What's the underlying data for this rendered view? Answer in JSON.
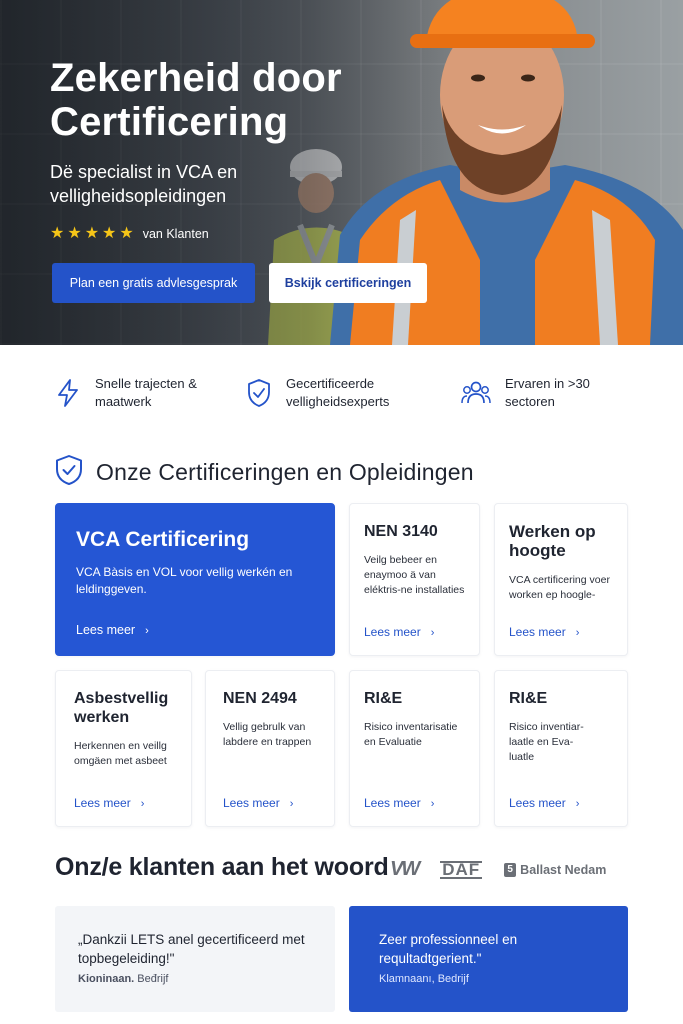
{
  "hero": {
    "title": "Zekerheid door Certificering",
    "subtitle": "Dë specialist in VCA en velligheidsopleidingen",
    "rating": {
      "stars": 5,
      "text": "van Klanten"
    },
    "primary_button": "Plan een gratis advlesgesprak",
    "secondary_button": "Bskijk certificeringen"
  },
  "features": [
    {
      "icon": "lightning-icon",
      "label": "Snelle trajecten & maatwerk"
    },
    {
      "icon": "shield-check-icon",
      "label": "Gecertificeerde velligheidsexperts"
    },
    {
      "icon": "people-icon",
      "label": "Ervaren in >30 sectoren"
    }
  ],
  "certifications": {
    "title": "Onze Certificeringen en Opleidingen",
    "link_label": "Lees meer",
    "cards": [
      {
        "title": "VCA Certificering",
        "description": "VCA Bàsis en VOL voor vellig werkén en leldinggeven."
      },
      {
        "title": "NEN 3140",
        "description": "Veilg bebeer en enaymoo ä van eléktris-ne installaties"
      },
      {
        "title": "Werken op hoogte",
        "description": "VCA certificering voer worken ep hoogle-"
      },
      {
        "title": "Asbestvellig werken",
        "description": "Herkennen en veillg omgäen met asbeet"
      },
      {
        "title": "NEN 2494",
        "description": "Vellig gebrulk van labdere en trappen"
      },
      {
        "title": "RI&E",
        "description": "Risico inventarisatie en Evaluatie"
      },
      {
        "title": "RI&E",
        "description": "Risico inventiar-laatle en Eva-luatle"
      }
    ]
  },
  "testimonials": {
    "title": "Onz/e klanten aan het woord",
    "logos": [
      "VW",
      "DAF",
      "Ballast Nedam"
    ],
    "quotes": [
      {
        "text": "„Dankzii LETS anel gecertificeerd met topbegeleiding!\"",
        "author_name": "Kioninaan.",
        "author_rest": " Beđrijf"
      },
      {
        "text": "Zeer professionneel en requltadtgerient.\"",
        "author_name": "Klamnaanı, Bedrijf",
        "author_rest": ""
      }
    ]
  },
  "colors": {
    "primary": "#2453c9",
    "star": "#f5c518",
    "text": "#1f2430"
  }
}
